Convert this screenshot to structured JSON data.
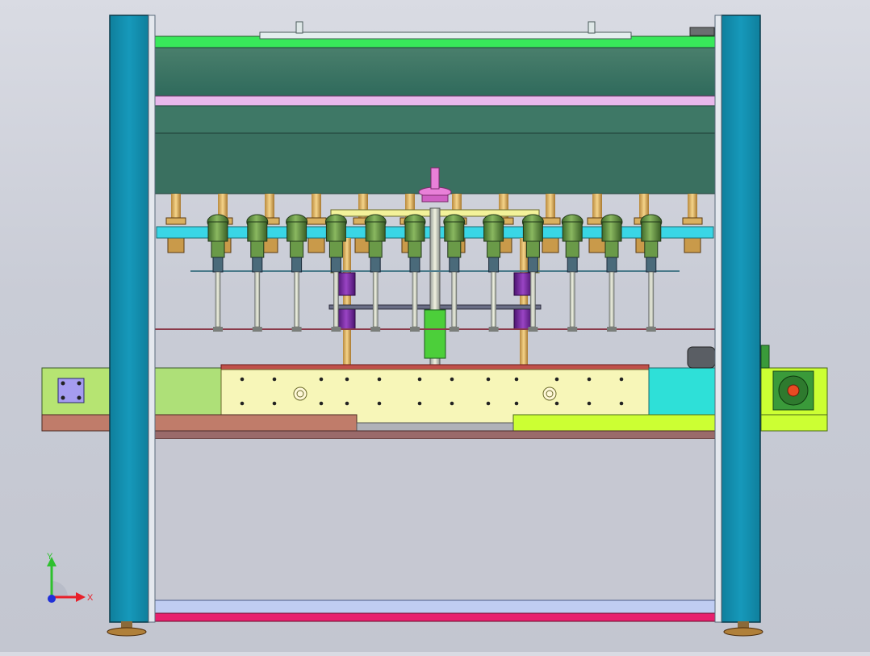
{
  "scene": {
    "view": "front",
    "colors": {
      "background": "#cfd1da",
      "column_blue": "#1590b0",
      "top_green": "#38e85a",
      "dark_panel": "#3f7a68",
      "pink_strip": "#e8b8ec",
      "cyan_bar": "#39d6e6",
      "nozzle_green": "#5e8a3c",
      "yellow_plate": "#f7f6b8",
      "lime_plate": "#ccff33",
      "salmon_plate": "#c07c6a",
      "bottom_magenta": "#e8206e",
      "bottom_blue": "#c0cdf2",
      "purple_guide": "#7a2a9e"
    },
    "nozzle_count": 12,
    "rod_count": 12
  },
  "triad": {
    "x_label": "X",
    "y_label": "Y",
    "x_color": "#e8202a",
    "y_color": "#2ec02e",
    "z_color": "#2030d8"
  }
}
